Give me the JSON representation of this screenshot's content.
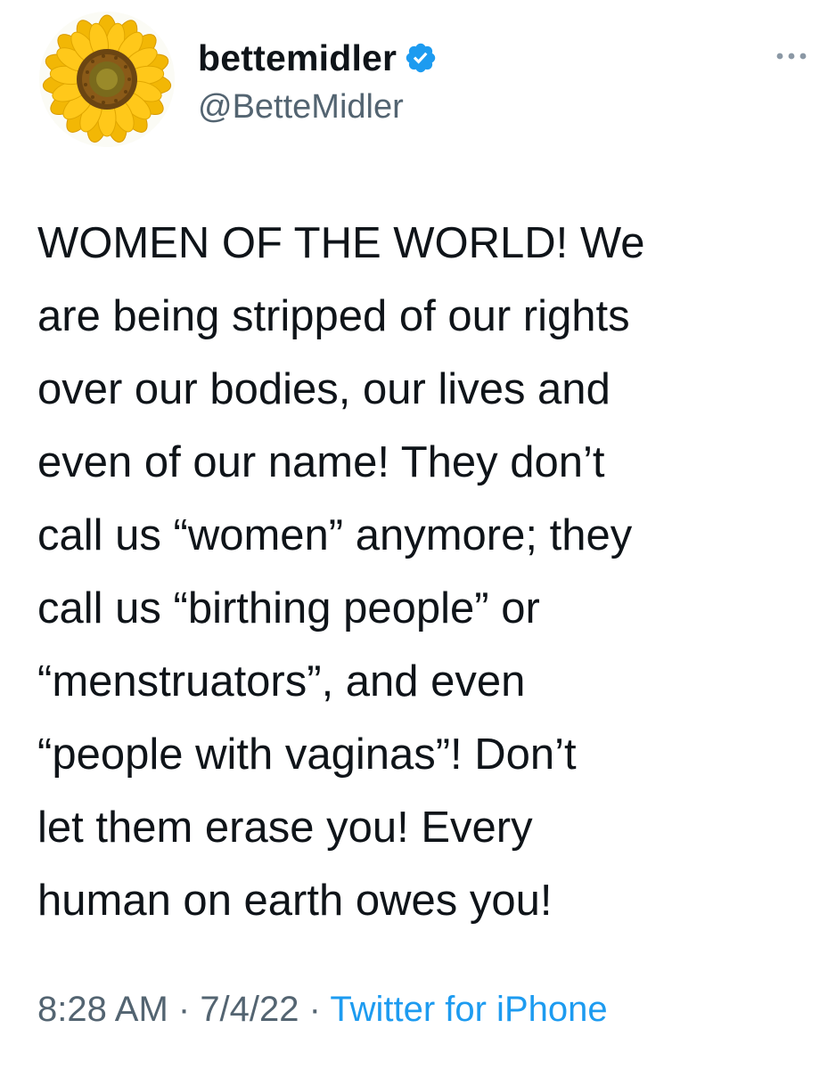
{
  "author": {
    "display_name": "bettemidler",
    "handle": "@BetteMidler",
    "verified": true,
    "avatar_icon": "sunflower-avatar"
  },
  "tweet": {
    "text": "WOMEN OF THE WORLD! We\nare being stripped of our rights\nover our bodies, our lives and\neven of our name! They don’t\ncall us “women” anymore; they\ncall us “birthing people” or\n“menstruators”, and even\n“people with vaginas”!  Don’t\nlet them erase you! Every\nhuman on earth owes you!",
    "time": "8:28 AM",
    "separator": " · ",
    "date": "7/4/22",
    "source": "Twitter for iPhone"
  },
  "icons": {
    "verified": "verified-badge-icon",
    "more": "more-options-icon"
  },
  "colors": {
    "text": "#0f1419",
    "secondary": "#536471",
    "link": "#1d9bf0",
    "verified": "#1d9bf0"
  }
}
